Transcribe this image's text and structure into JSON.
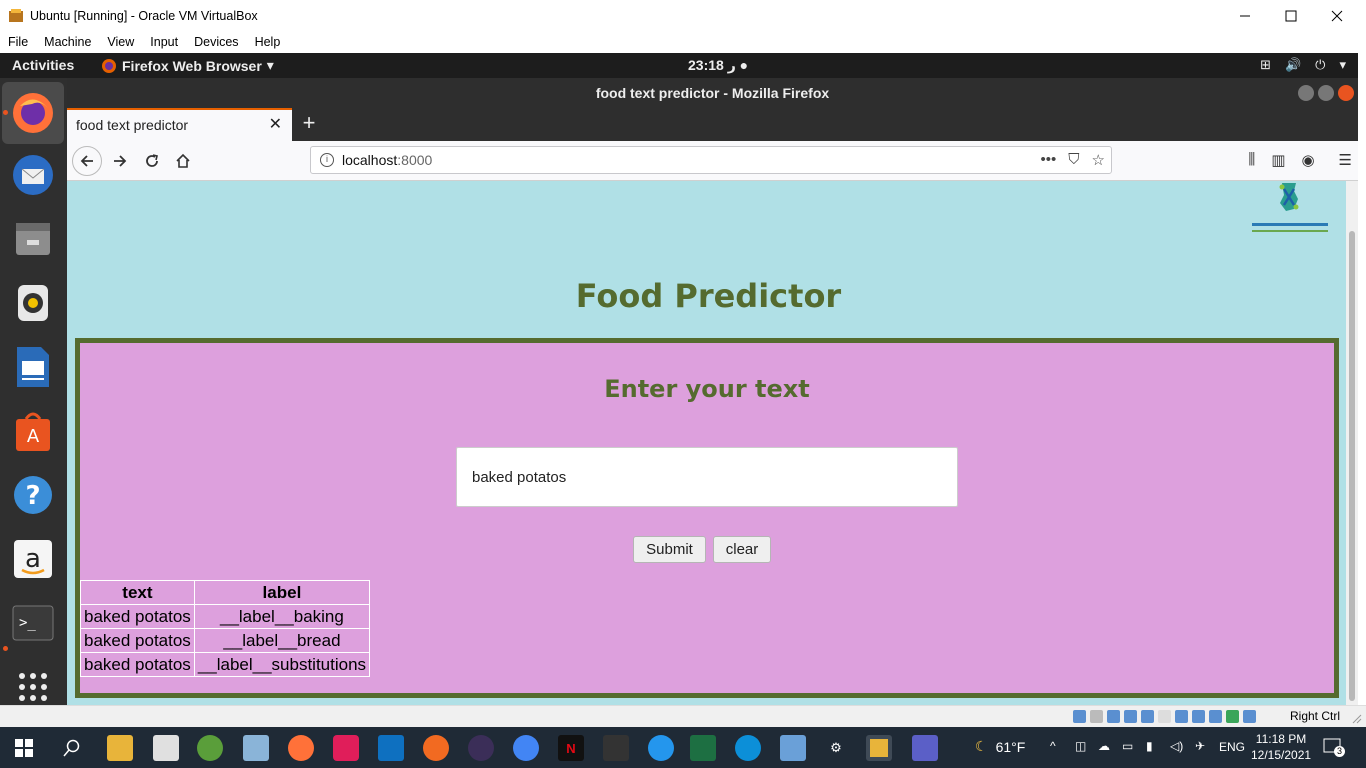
{
  "host_window": {
    "title": "Ubuntu [Running] - Oracle VM VirtualBox",
    "menu": [
      "File",
      "Machine",
      "View",
      "Input",
      "Devices",
      "Help"
    ],
    "status_host_key": "Right Ctrl"
  },
  "gnome": {
    "activities": "Activities",
    "app_menu": "Firefox Web Browser",
    "clock": "23:18 ر"
  },
  "firefox": {
    "window_title": "food text predictor - Mozilla Firefox",
    "tab_title": "food text predictor",
    "url_host": "localhost",
    "url_port": ":8000"
  },
  "page": {
    "title": "Food Predictor",
    "panel_heading": "Enter your text",
    "input_value": "baked potatos",
    "submit_label": "Submit",
    "clear_label": "clear",
    "results": {
      "headers": [
        "text",
        "label"
      ],
      "rows": [
        [
          "baked potatos",
          "__label__baking"
        ],
        [
          "baked potatos",
          "__label__bread"
        ],
        [
          "baked potatos",
          "__label__substitutions"
        ]
      ]
    }
  },
  "taskbar": {
    "temperature": "61°F",
    "language": "ENG",
    "time": "11:18 PM",
    "date": "12/15/2021",
    "notifications": "3"
  }
}
